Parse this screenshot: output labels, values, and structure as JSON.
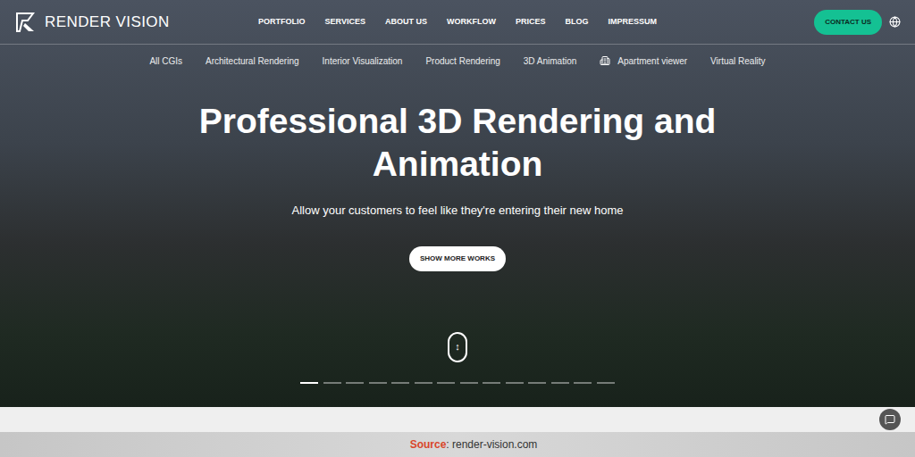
{
  "logo": {
    "text": "RENDER VISION"
  },
  "nav": {
    "items": [
      "PORTFOLIO",
      "SERVICES",
      "ABOUT US",
      "WORKFLOW",
      "PRICES",
      "BLOG",
      "IMPRESSUM"
    ],
    "contact": "CONTACT US"
  },
  "subnav": {
    "items": [
      {
        "label": "All CGIs",
        "kind": "plain"
      },
      {
        "label": "Architectural Rendering",
        "kind": "plain"
      },
      {
        "label": "Interior Visualization",
        "kind": "plain"
      },
      {
        "label": "Product Rendering",
        "kind": "plain"
      },
      {
        "label": "3D Animation",
        "kind": "plain"
      },
      {
        "label": "Apartment viewer",
        "kind": "icon"
      },
      {
        "label": "Virtual Reality",
        "kind": "plain"
      }
    ]
  },
  "hero": {
    "title": "Professional 3D Rendering and Animation",
    "subtitle": "Allow your customers to feel like they're entering their new home",
    "button": "SHOW MORE WORKS",
    "scroll_icon": "↕"
  },
  "slider": {
    "dots": [
      {
        "selected": true
      },
      {
        "selected": false
      },
      {
        "selected": false
      },
      {
        "selected": false
      },
      {
        "selected": false
      },
      {
        "selected": false
      },
      {
        "selected": false
      },
      {
        "selected": false
      },
      {
        "selected": false
      },
      {
        "selected": false
      },
      {
        "selected": false
      },
      {
        "selected": false
      },
      {
        "selected": false
      },
      {
        "selected": false
      }
    ]
  },
  "footer": {
    "label": "Source",
    "text": ": render-vision.com"
  }
}
